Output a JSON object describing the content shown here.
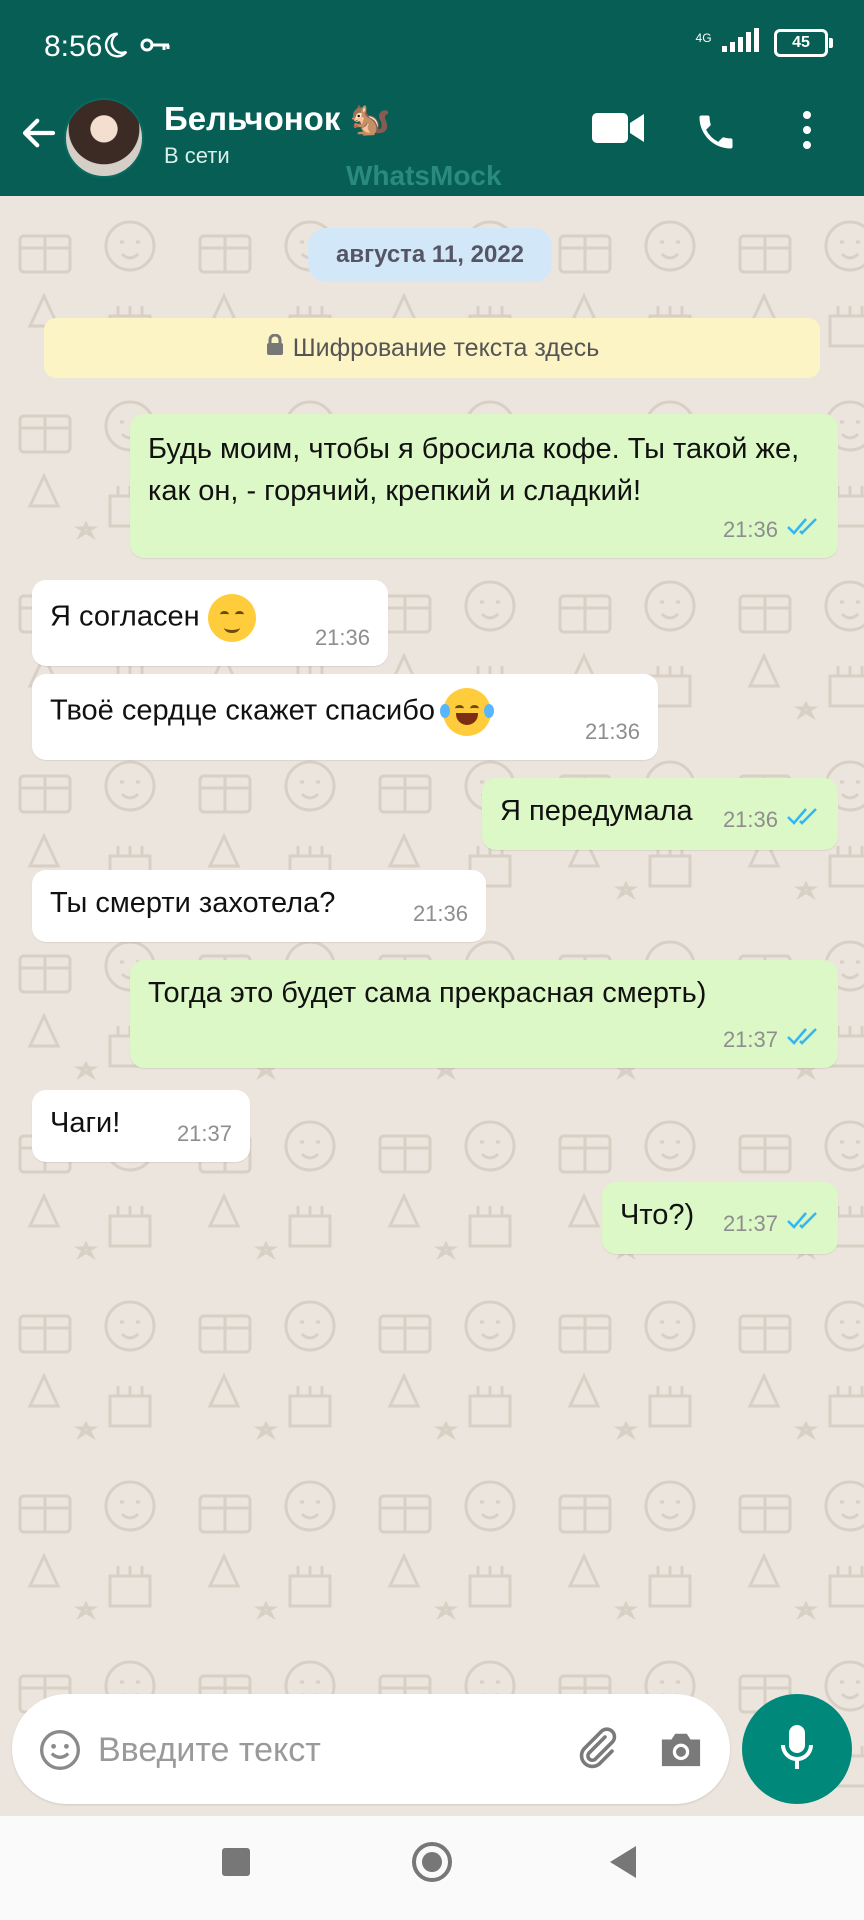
{
  "status_bar": {
    "time": "8:56",
    "network": "4G",
    "battery": "45"
  },
  "header": {
    "contact_name": "Бельчонок 🐿️",
    "contact_status": "В сети",
    "watermark": "WhatsMock"
  },
  "chat": {
    "date_chip": "августа 11, 2022",
    "encryption_notice": "Шифрование текста здесь",
    "messages": [
      {
        "direction": "out",
        "text": "Будь моим, чтобы я бросила кофе. Ты такой же, как он, - горячий, крепкий и сладкий!",
        "time": "21:36",
        "read": true
      },
      {
        "direction": "in",
        "text": "Я согласен",
        "emoji": "relieved-face-emoji",
        "time": "21:36"
      },
      {
        "direction": "in",
        "text": "Твоё сердце скажет спасибо",
        "emoji": "tears-of-joy-emoji",
        "time": "21:36"
      },
      {
        "direction": "out",
        "text": "Я передумала",
        "time": "21:36",
        "read": true
      },
      {
        "direction": "in",
        "text": "Ты смерти захотела?",
        "time": "21:36"
      },
      {
        "direction": "out",
        "text": "Тогда это будет сама прекрасная смерть)",
        "time": "21:37",
        "read": true
      },
      {
        "direction": "in",
        "text": "Чаги!",
        "time": "21:37"
      },
      {
        "direction": "out",
        "text": "Что?)",
        "time": "21:37",
        "read": true
      }
    ]
  },
  "composer": {
    "placeholder": "Введите текст"
  },
  "colors": {
    "header": "#075e54",
    "outgoing_bubble": "#dcf8c6",
    "incoming_bubble": "#ffffff",
    "accent": "#00897b",
    "read_ticks": "#34b7f1"
  },
  "icons": [
    "back-arrow-icon",
    "video-call-icon",
    "phone-icon",
    "more-vert-icon",
    "lock-icon",
    "double-check-icon",
    "emoji-icon",
    "attach-icon",
    "camera-icon",
    "mic-icon"
  ]
}
